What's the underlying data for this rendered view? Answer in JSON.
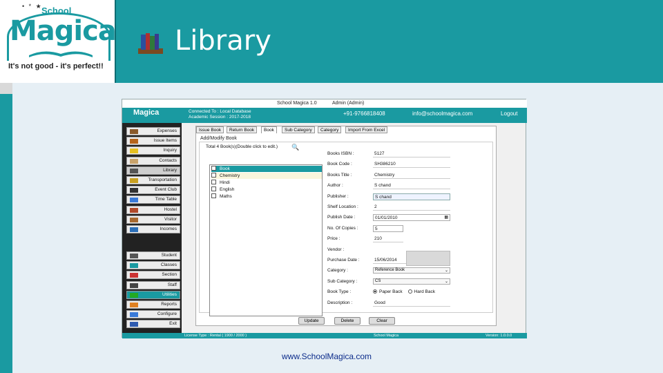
{
  "slide": {
    "title": "Library",
    "footer_url": "www.SchoolMagica.com"
  },
  "logo": {
    "stars": "• * ★",
    "school": "School",
    "brand": "Magica",
    "tagline": "It's not good - it's perfect!!"
  },
  "colors": {
    "accent": "#1a9aa1",
    "header_band": "#1a9aa1",
    "background": "#e6eff5"
  },
  "app": {
    "titlebar": {
      "app_name": "School Magica 1.0",
      "user": "Admin (Admin)"
    },
    "header": {
      "logo": "Magica",
      "connected": "Connected To : Local Database",
      "session": "Academic Session : 2017-2018",
      "phone": "+91-9766818408",
      "email": "info@schoolmagica.com",
      "logout": "Logout"
    },
    "sidebar_top": [
      {
        "label": "Expenses",
        "icon": "expenses-icon"
      },
      {
        "label": "Issue Items",
        "icon": "issue-items-icon"
      },
      {
        "label": "Inquiry",
        "icon": "inquiry-icon"
      },
      {
        "label": "Contacts",
        "icon": "contacts-icon"
      },
      {
        "label": "Library",
        "icon": "library-icon"
      },
      {
        "label": "Transportation",
        "icon": "bus-icon"
      },
      {
        "label": "Event Club",
        "icon": "event-icon"
      },
      {
        "label": "Time Table",
        "icon": "timetable-icon"
      },
      {
        "label": "Hostel",
        "icon": "hostel-icon"
      },
      {
        "label": "Visitor",
        "icon": "visitor-icon"
      },
      {
        "label": "Incomes",
        "icon": "incomes-icon"
      }
    ],
    "sidebar_bottom": [
      {
        "label": "Student",
        "icon": "student-icon"
      },
      {
        "label": "Classes",
        "icon": "classes-icon"
      },
      {
        "label": "Section",
        "icon": "section-icon"
      },
      {
        "label": "Staff",
        "icon": "staff-icon"
      },
      {
        "label": "Utilities",
        "icon": "utilities-icon"
      },
      {
        "label": "Reports",
        "icon": "reports-icon"
      },
      {
        "label": "Configure",
        "icon": "configure-icon"
      },
      {
        "label": "Exit",
        "icon": "exit-icon"
      }
    ],
    "tabs": [
      "Issue Book",
      "Return Book",
      "Book",
      "Sub Category",
      "Category",
      "Import From Excel"
    ],
    "active_tab": "Book",
    "group_label": "Add/Modify Book",
    "list_label": "Total 4 Book(s)(Double click to edit.)",
    "books": [
      {
        "name": "Book",
        "selected": true
      },
      {
        "name": "Chemistry",
        "highlighted": true
      },
      {
        "name": "Hindi"
      },
      {
        "name": "English"
      },
      {
        "name": "Maths"
      }
    ],
    "fields": [
      {
        "label": "Books ISBN :",
        "value": "5127"
      },
      {
        "label": "Book Code :",
        "value": "SH386210"
      },
      {
        "label": "Books Title :",
        "value": "Chemistry"
      },
      {
        "label": "Author :",
        "value": "S chand"
      },
      {
        "label": "Publisher :",
        "value": "S chand"
      },
      {
        "label": "Shelf Location :",
        "value": "2"
      },
      {
        "label": "Publish Date :",
        "value": "01/01/2010"
      },
      {
        "label": "No. Of Copies :",
        "value": "5"
      },
      {
        "label": "Price :",
        "value": "210"
      },
      {
        "label": "Vendor :",
        "value": ""
      },
      {
        "label": "Purchase Date :",
        "value": "15/06/2014"
      },
      {
        "label": "Category :",
        "value": "Reference Book"
      },
      {
        "label": "Sub Category :",
        "value": "CS"
      },
      {
        "label": "Book Type :",
        "value": ""
      },
      {
        "label": "Description :",
        "value": "Good"
      }
    ],
    "book_type_options": [
      "Paper Back",
      "Hard Back"
    ],
    "book_type_selected": "Paper Back",
    "buttons": {
      "update": "Update",
      "delete": "Delete",
      "clear": "Clear"
    },
    "status": {
      "license": "License Type : Rental ( 1900 / 2000 )",
      "product": "School Magica",
      "version": "Version: 1.0.0.0"
    }
  }
}
